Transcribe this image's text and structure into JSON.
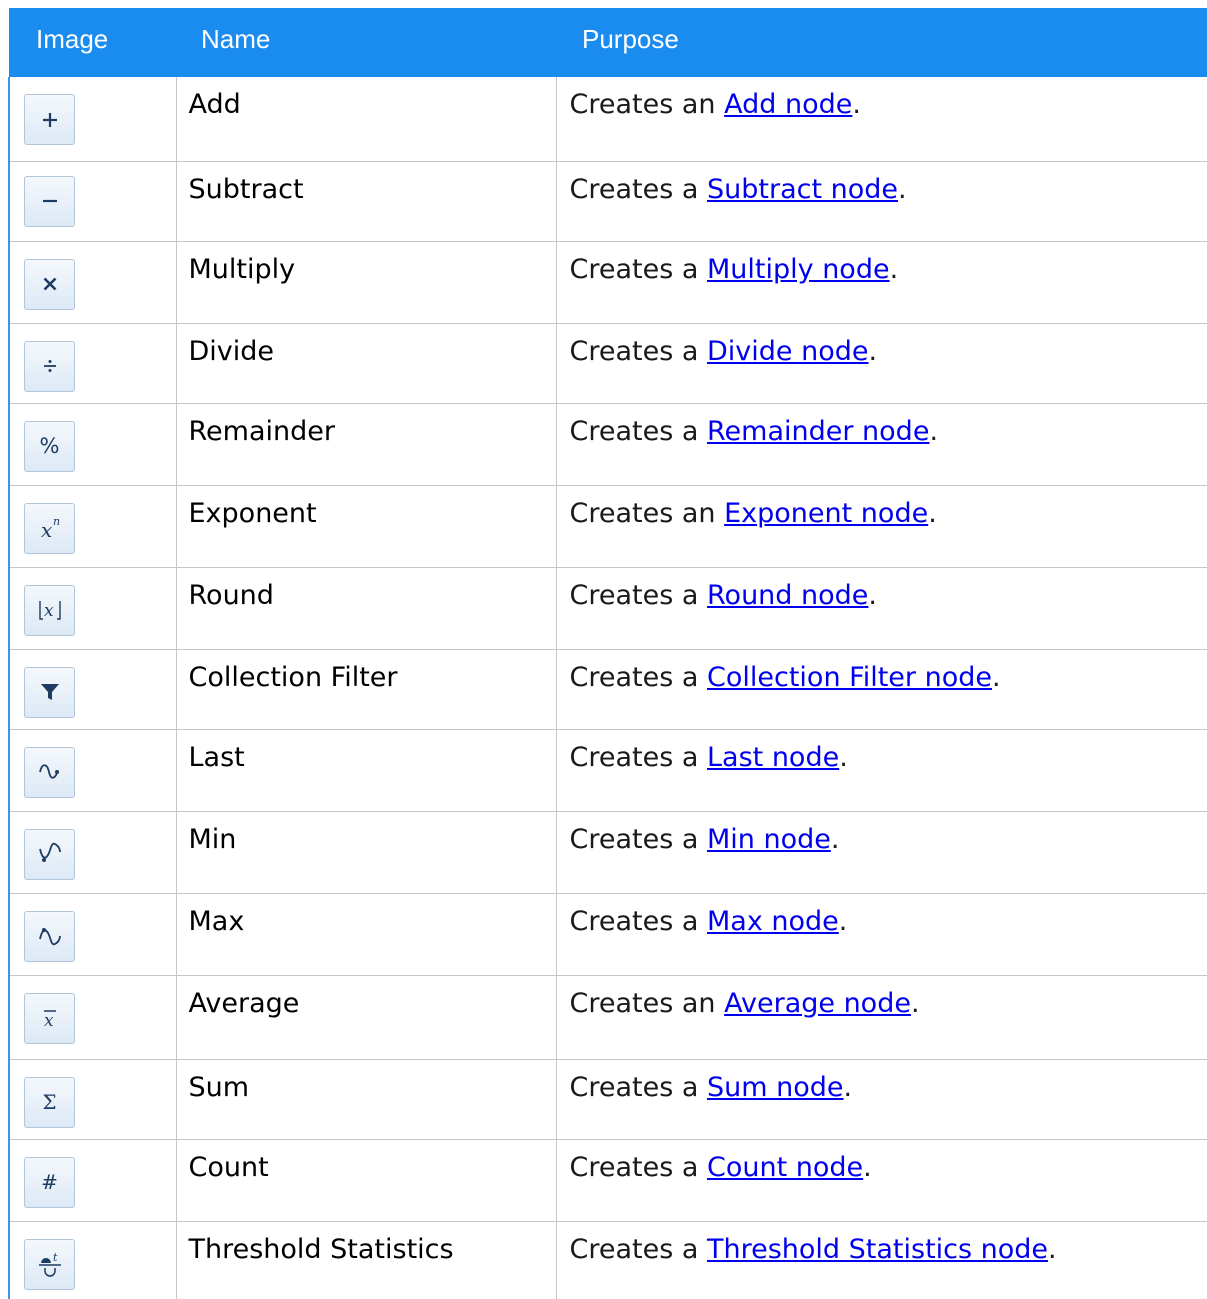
{
  "table": {
    "headers": {
      "image": "Image",
      "name": "Name",
      "purpose": "Purpose"
    },
    "rows": [
      {
        "icon": "add-icon",
        "name": "Add",
        "prefix": "Creates an ",
        "link": "Add node",
        "suffix": "."
      },
      {
        "icon": "subtract-icon",
        "name": "Subtract",
        "prefix": "Creates a ",
        "link": "Subtract node",
        "suffix": "."
      },
      {
        "icon": "multiply-icon",
        "name": "Multiply",
        "prefix": "Creates a ",
        "link": "Multiply node",
        "suffix": "."
      },
      {
        "icon": "divide-icon",
        "name": "Divide",
        "prefix": "Creates a ",
        "link": "Divide node",
        "suffix": "."
      },
      {
        "icon": "remainder-icon",
        "name": "Remainder",
        "prefix": "Creates a ",
        "link": "Remainder node",
        "suffix": "."
      },
      {
        "icon": "exponent-icon",
        "name": "Exponent",
        "prefix": "Creates an ",
        "link": "Exponent node",
        "suffix": "."
      },
      {
        "icon": "round-icon",
        "name": "Round",
        "prefix": "Creates a ",
        "link": "Round node",
        "suffix": "."
      },
      {
        "icon": "filter-icon",
        "name": "Collection Filter",
        "prefix": "Creates a ",
        "link": "Collection Filter node",
        "suffix": "."
      },
      {
        "icon": "last-icon",
        "name": "Last",
        "prefix": "Creates a ",
        "link": "Last node",
        "suffix": "."
      },
      {
        "icon": "min-icon",
        "name": "Min",
        "prefix": "Creates a ",
        "link": "Min node",
        "suffix": "."
      },
      {
        "icon": "max-icon",
        "name": "Max",
        "prefix": "Creates a ",
        "link": "Max node",
        "suffix": "."
      },
      {
        "icon": "average-icon",
        "name": "Average",
        "prefix": "Creates an ",
        "link": "Average node",
        "suffix": "."
      },
      {
        "icon": "sum-icon",
        "name": "Sum",
        "prefix": "Creates a ",
        "link": "Sum node",
        "suffix": "."
      },
      {
        "icon": "count-icon",
        "name": "Count",
        "prefix": "Creates a ",
        "link": "Count node",
        "suffix": "."
      },
      {
        "icon": "threshold-statistics-icon",
        "name": "Threshold Statistics",
        "prefix": "Creates a ",
        "link": "Threshold Statistics node",
        "suffix": "."
      }
    ]
  },
  "colors": {
    "header_bg": "#1a8cf0",
    "header_text": "#ffffff",
    "link": "#0000ee",
    "grid_line": "#c6c6c6",
    "left_border": "#3b95ea"
  }
}
